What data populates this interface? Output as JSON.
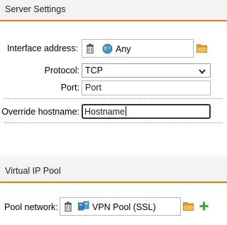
{
  "server_settings": {
    "title": "Server Settings",
    "interface_address": {
      "label": "Interface address:",
      "value": "Any"
    },
    "protocol": {
      "label": "Protocol:",
      "value": "TCP"
    },
    "port": {
      "label": "Port:",
      "placeholder": "Port"
    },
    "override_hostname": {
      "label": "Override hostname:",
      "placeholder": "Hostname"
    }
  },
  "virtual_ip_pool": {
    "title": "Virtual IP Pool",
    "pool_network": {
      "label": "Pool network:",
      "value": "VPN Pool (SSL)"
    }
  },
  "colors": {
    "accent": "#f07b12",
    "folder": "#e8a020",
    "add": "#3aa63a"
  },
  "icons": [
    "trash-icon",
    "globe-icon",
    "folder-icon",
    "chevron-down-icon",
    "network-pool-icon",
    "plus-icon"
  ]
}
